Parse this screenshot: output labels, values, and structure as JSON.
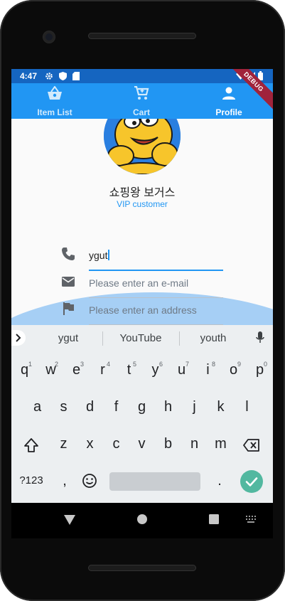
{
  "status_bar": {
    "time": "4:47",
    "debug_banner": "DEBUG"
  },
  "tabs": [
    {
      "label": "Item List",
      "icon": "basket-icon",
      "selected": false
    },
    {
      "label": "Cart",
      "icon": "cart-icon",
      "selected": false
    },
    {
      "label": "Profile",
      "icon": "person-icon",
      "selected": true
    }
  ],
  "profile": {
    "name": "쇼핑왕 보거스",
    "level": "VIP customer"
  },
  "fields": {
    "phone": {
      "value": "ygut",
      "icon": "phone-icon"
    },
    "email": {
      "placeholder": "Please enter an e-mail",
      "icon": "mail-icon"
    },
    "address": {
      "placeholder": "Please enter an address",
      "icon": "flag-icon"
    }
  },
  "keyboard": {
    "suggestions": [
      "ygut",
      "YouTube",
      "youth"
    ],
    "row1": [
      "q",
      "w",
      "e",
      "r",
      "t",
      "y",
      "u",
      "i",
      "o",
      "p"
    ],
    "row1_hints": [
      "1",
      "2",
      "3",
      "4",
      "5",
      "6",
      "7",
      "8",
      "9",
      "0"
    ],
    "row2": [
      "a",
      "s",
      "d",
      "f",
      "g",
      "h",
      "j",
      "k",
      "l"
    ],
    "row3": [
      "z",
      "x",
      "c",
      "v",
      "b",
      "n",
      "m"
    ],
    "symbols_key": "?123",
    "comma_key": ",",
    "period_key": ".",
    "accent_color": "#52b8a0"
  },
  "colors": {
    "app_bar": "#2196f3",
    "status_bar": "#1565c0",
    "wave": "#a6cff5"
  }
}
